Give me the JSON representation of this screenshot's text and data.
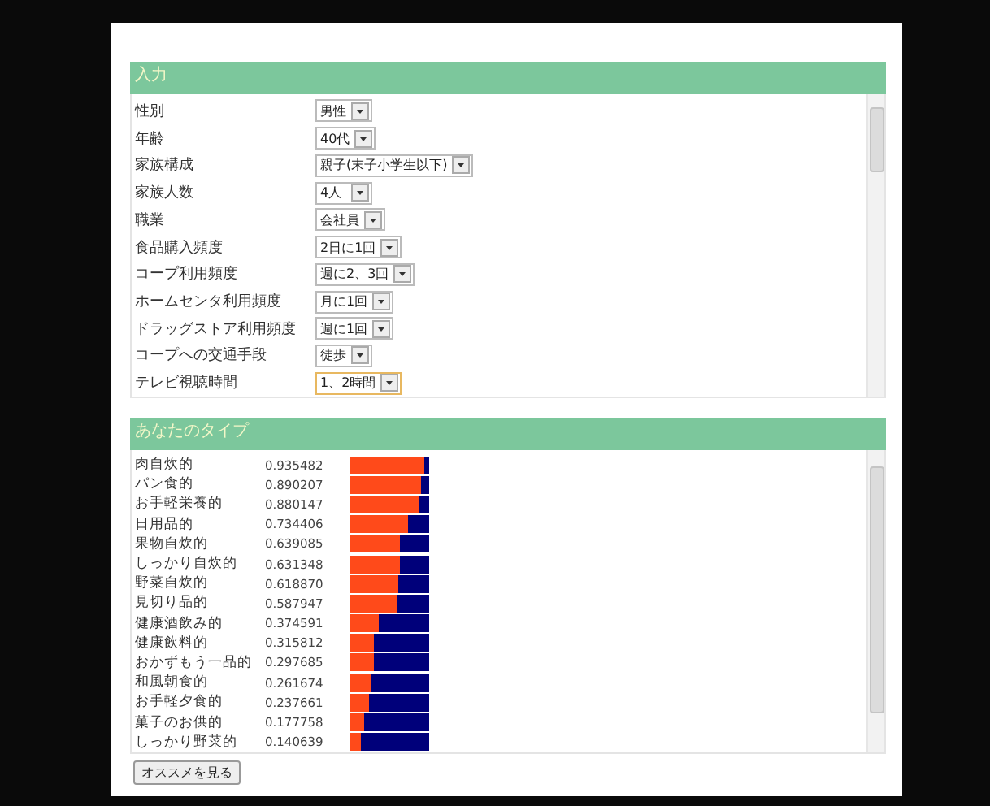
{
  "input_section": {
    "title": "入力",
    "fields": [
      {
        "label": "性別",
        "value": "男性",
        "focused": false
      },
      {
        "label": "年齢",
        "value": "40代",
        "focused": false
      },
      {
        "label": "家族構成",
        "value": "親子(末子小学生以下)",
        "focused": false
      },
      {
        "label": "家族人数",
        "value": "4人",
        "focused": false
      },
      {
        "label": "職業",
        "value": "会社員",
        "focused": false
      },
      {
        "label": "食品購入頻度",
        "value": "2日に1回",
        "focused": false
      },
      {
        "label": "コープ利用頻度",
        "value": "週に2、3回",
        "focused": false
      },
      {
        "label": "ホームセンタ利用頻度",
        "value": "月に1回",
        "focused": false
      },
      {
        "label": "ドラッグストア利用頻度",
        "value": "週に1回",
        "focused": false
      },
      {
        "label": "コープへの交通手段",
        "value": "徒歩",
        "focused": false
      },
      {
        "label": "テレビ視聴時間",
        "value": "1、2時間",
        "focused": true
      }
    ]
  },
  "type_section": {
    "title": "あなたのタイプ",
    "types": [
      {
        "name": "肉自炊的",
        "score": "0.935482",
        "level": 0.935
      },
      {
        "name": "パン食的",
        "score": "0.890207",
        "level": 0.89
      },
      {
        "name": "お手軽栄養的",
        "score": "0.880147",
        "level": 0.88
      },
      {
        "name": "日用品的",
        "score": "0.734406",
        "level": 0.734
      },
      {
        "name": "果物自炊的",
        "score": "0.639085",
        "level": 0.639
      },
      {
        "name": "しっかり自炊的",
        "score": "0.631348",
        "level": 0.631
      },
      {
        "name": "野菜自炊的",
        "score": "0.618870",
        "level": 0.619
      },
      {
        "name": "見切り品的",
        "score": "0.587947",
        "level": 0.588
      },
      {
        "name": "健康酒飲み的",
        "score": "0.374591",
        "level": 0.375
      },
      {
        "name": "健康飲料的",
        "score": "0.315812",
        "level": 0.316
      },
      {
        "name": "おかずもう一品的",
        "score": "0.297685",
        "level": 0.298
      },
      {
        "name": "和風朝食的",
        "score": "0.261674",
        "level": 0.262
      },
      {
        "name": "お手軽夕食的",
        "score": "0.237661",
        "level": 0.238
      },
      {
        "name": "菓子のお供的",
        "score": "0.177758",
        "level": 0.178
      },
      {
        "name": "しっかり野菜的",
        "score": "0.140639",
        "level": 0.141
      }
    ]
  },
  "recommend_button": "オススメを見る"
}
